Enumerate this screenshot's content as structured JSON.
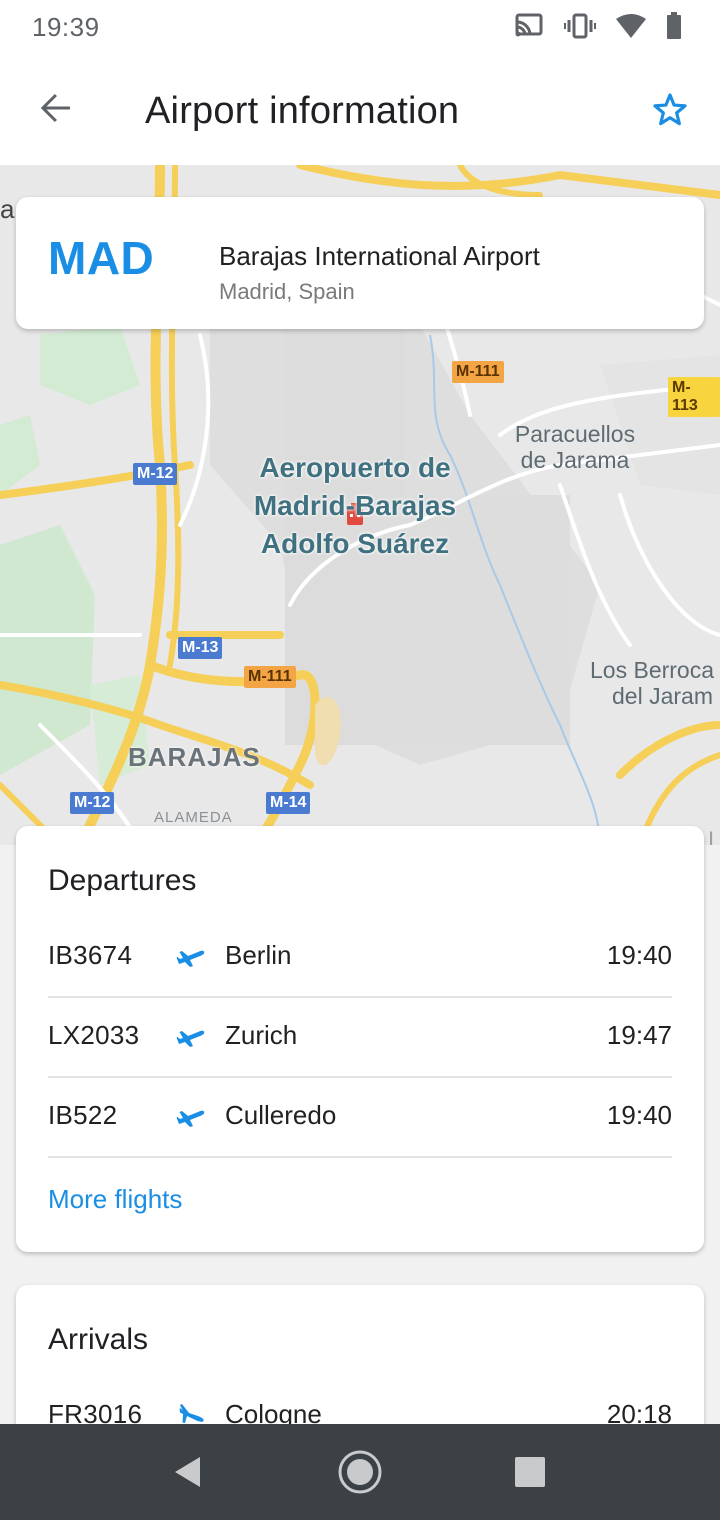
{
  "status_bar": {
    "time": "19:39",
    "icons": [
      "cast-icon",
      "vibrate-icon",
      "wifi-icon",
      "battery-icon"
    ]
  },
  "app_bar": {
    "title": "Airport information",
    "back_icon": "arrow-back-icon",
    "favorite_icon": "star-outline-icon",
    "accent_color": "#1a8ee4"
  },
  "map": {
    "airport_label": [
      "Aeropuerto de",
      "Madrid-Barajas",
      "Adolfo Suárez"
    ],
    "place_labels": {
      "paracuellos": [
        "Paracuellos",
        "de Jarama"
      ],
      "berrocales": [
        "Los Berroca",
        "del Jaram"
      ],
      "barajas": "BARAJAS",
      "alameda": "ALAMEDA",
      "edge_left": "a",
      "edge_right": "I"
    },
    "road_shields": {
      "m12_top": "M-12",
      "m13": "M-13",
      "m111_top": "M-111",
      "m111_bottom": "M-111",
      "m113": "M-113",
      "m12_bottom": "M-12",
      "m14": "M-14"
    }
  },
  "airport": {
    "code": "MAD",
    "name": "Barajas International Airport",
    "location": "Madrid, Spain"
  },
  "departures": {
    "heading": "Departures",
    "flights": [
      {
        "number": "IB3674",
        "destination": "Berlin",
        "time": "19:40"
      },
      {
        "number": "LX2033",
        "destination": "Zurich",
        "time": "19:47"
      },
      {
        "number": "IB522",
        "destination": "Culleredo",
        "time": "19:40"
      }
    ],
    "more_label": "More flights"
  },
  "arrivals": {
    "heading": "Arrivals",
    "flights": [
      {
        "number": "FR3016",
        "origin": "Cologne",
        "time": "20:18"
      }
    ]
  },
  "nav_bar": {
    "buttons": [
      "back-triangle-icon",
      "home-circle-icon",
      "recents-square-icon"
    ]
  }
}
